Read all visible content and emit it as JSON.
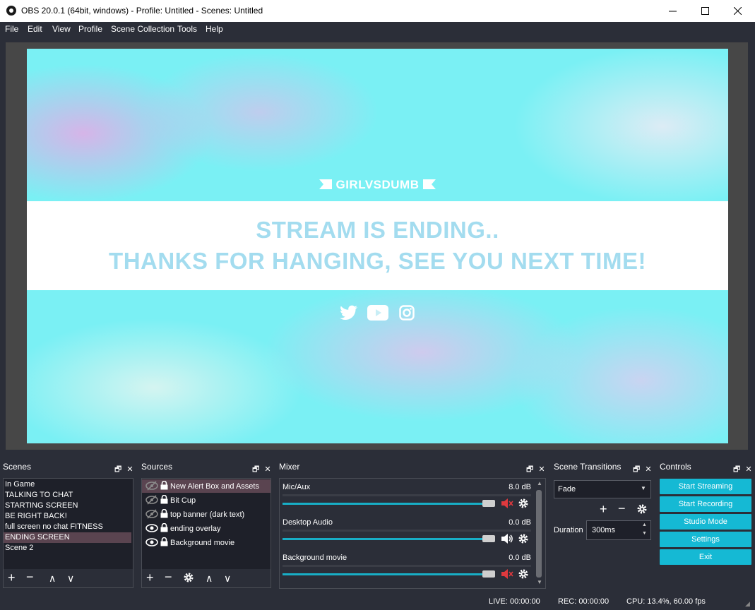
{
  "window": {
    "title": "OBS 20.0.1 (64bit, windows) - Profile: Untitled - Scenes: Untitled"
  },
  "menu": [
    "File",
    "Edit",
    "View",
    "Profile",
    "Scene Collection",
    "Tools",
    "Help"
  ],
  "preview": {
    "brand": "GIRLVSDUMB",
    "line1": "STREAM IS ENDING..",
    "line2": "THANKS FOR HANGING, SEE YOU NEXT TIME!"
  },
  "scenes": {
    "title": "Scenes",
    "items": [
      "In Game",
      "TALKING TO CHAT",
      "STARTING SCREEN",
      "BE RIGHT BACK!",
      "full screen no chat FITNESS",
      "ENDING SCREEN",
      "Scene 2"
    ],
    "selected": "ENDING SCREEN"
  },
  "sources": {
    "title": "Sources",
    "items": [
      {
        "name": "New Alert Box and Assets",
        "visible": false,
        "locked": true,
        "selected": true
      },
      {
        "name": "Bit Cup",
        "visible": false,
        "locked": true,
        "selected": false
      },
      {
        "name": "top banner (dark text)",
        "visible": false,
        "locked": true,
        "selected": false
      },
      {
        "name": "ending overlay",
        "visible": true,
        "locked": true,
        "selected": false
      },
      {
        "name": "Background movie",
        "visible": true,
        "locked": true,
        "selected": false
      }
    ]
  },
  "mixer": {
    "title": "Mixer",
    "channels": [
      {
        "name": "Mic/Aux",
        "db": "8.0 dB",
        "muted": true
      },
      {
        "name": "Desktop Audio",
        "db": "0.0 dB",
        "muted": false
      },
      {
        "name": "Background movie",
        "db": "0.0 dB",
        "muted": true
      }
    ]
  },
  "transitions": {
    "title": "Scene Transitions",
    "selected": "Fade",
    "duration_label": "Duration",
    "duration_value": "300ms"
  },
  "controls": {
    "title": "Controls",
    "buttons": [
      "Start Streaming",
      "Start Recording",
      "Studio Mode",
      "Settings",
      "Exit"
    ]
  },
  "status": {
    "live": "LIVE: 00:00:00",
    "rec": "REC: 00:00:00",
    "cpu": "CPU: 13.4%, 60.00 fps"
  },
  "colors": {
    "accent": "#15b9d4",
    "background": "#2b2e38",
    "muted_icon": "#e0393e"
  }
}
